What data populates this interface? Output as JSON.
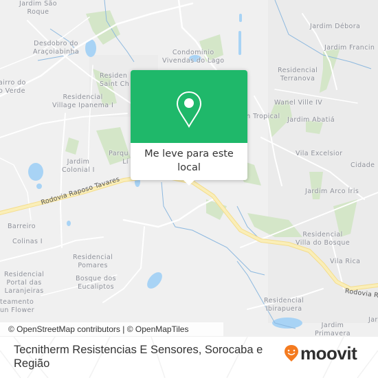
{
  "map": {
    "place_labels": [
      {
        "text": "Jardim São\nRoque",
        "id": "jardim-sao-roque"
      },
      {
        "text": "Desdobro do\nAraçoiabinha",
        "id": "desdobro-do-aracoiabinha"
      },
      {
        "text": "Condominio\nVivendas do Lago",
        "id": "condominio-vivendas-do-lago"
      },
      {
        "text": "Jardim Débora",
        "id": "jardim-debora"
      },
      {
        "text": "Jardim Francin",
        "id": "jardim-francin"
      },
      {
        "text": "Residencial\nTerranova",
        "id": "residencial-terranova"
      },
      {
        "text": "airro do\no Verde",
        "id": "bairro-do-verde"
      },
      {
        "text": "Residen\nSaint Ch",
        "id": "residencial-saint-ch"
      },
      {
        "text": "Residencial\nVillage Ipanema I",
        "id": "residencial-village-ipanema"
      },
      {
        "text": "Wanel Ville IV",
        "id": "wanel-ville-iv"
      },
      {
        "text": "m Tropical",
        "id": "jardim-tropical"
      },
      {
        "text": "Jardim Abatiá",
        "id": "jardim-abatia"
      },
      {
        "text": "Vila Excelsior",
        "id": "vila-excelsior"
      },
      {
        "text": "Cidade",
        "id": "cidade"
      },
      {
        "text": "Parqu\nLí",
        "id": "parque-li"
      },
      {
        "text": "Jardim\nColonial I",
        "id": "jardim-colonial"
      },
      {
        "text": "Jardim Arco Íris",
        "id": "jardim-arco-iris"
      },
      {
        "text": "Barreiro",
        "id": "barreiro"
      },
      {
        "text": "Colinas I",
        "id": "colinas-i"
      },
      {
        "text": "Residencial\nPomares",
        "id": "residencial-pomares"
      },
      {
        "text": "Residencial\nVilla do Bosque",
        "id": "residencial-villa-do-bosque"
      },
      {
        "text": "Residencial\nPortal das\nLaranjeiras",
        "id": "residencial-portal-das-laranjeiras"
      },
      {
        "text": "Bosque dos\nEucaliptos",
        "id": "bosque-dos-eucaliptos"
      },
      {
        "text": "Vila Rica",
        "id": "vila-rica"
      },
      {
        "text": "teamento\nun Flower",
        "id": "loteamento-sun-flower"
      },
      {
        "text": "Residencial\nIbirapuera",
        "id": "residencial-ibirapuera"
      },
      {
        "text": "Jardim\nPrimavera",
        "id": "jardim-primavera"
      },
      {
        "text": "Jar",
        "id": "jar"
      }
    ],
    "road_labels": [
      {
        "text": "Rodovia Raposo Tavares",
        "id": "rodovia-raposo-tavares-west"
      },
      {
        "text": "Rodovia R",
        "id": "rodovia-raposo-tavares-east"
      }
    ],
    "attribution": {
      "osm": "© OpenStreetMap contributors",
      "separator": " | ",
      "omt": "© OpenMapTiles"
    },
    "colors": {
      "background": "#f0f0f0",
      "park": "#d4e6c8",
      "water": "#a8d3f5",
      "highway": "#f8e9a6",
      "road": "#ffffff"
    }
  },
  "popup": {
    "label": "Me leve para este local",
    "line1": "Me leve para este",
    "line2": "local",
    "icon": "map-pin-icon",
    "color": "#1fb86a"
  },
  "footer": {
    "title": "Tecnitherm Resistencias E Sensores, Sorocaba e Região",
    "brand": "moovit",
    "brand_color": "#f47b20"
  }
}
